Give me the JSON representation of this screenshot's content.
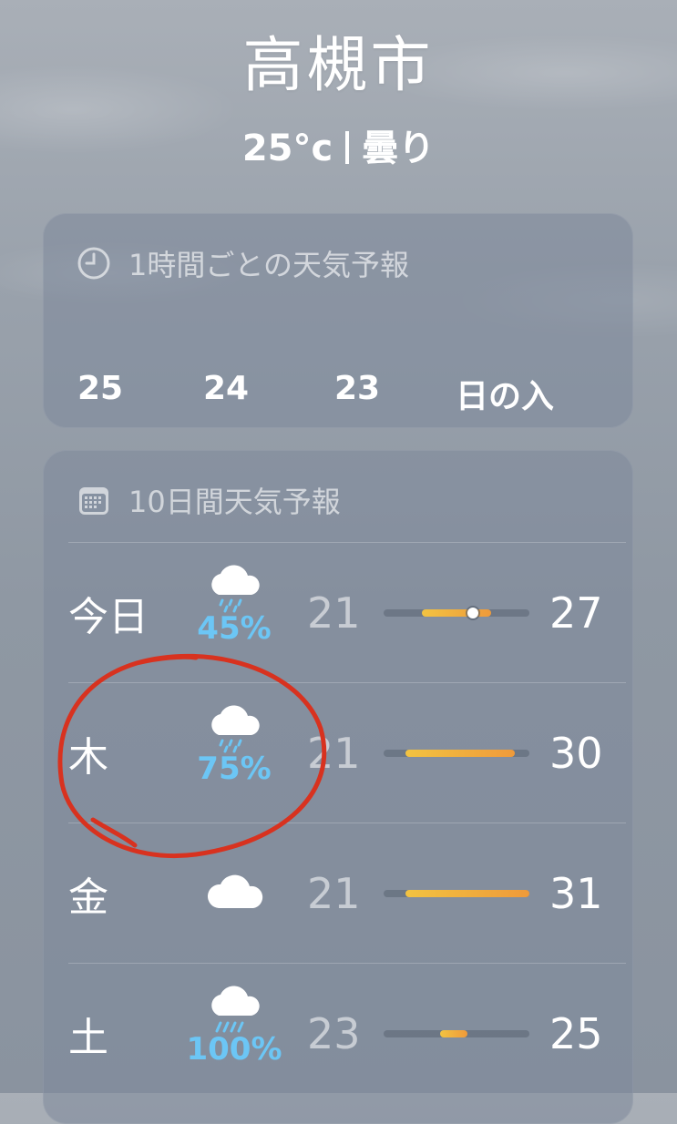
{
  "location": {
    "city": "高槻市",
    "temperature": "25°c",
    "condition": "曇り"
  },
  "hourly": {
    "title": "1時間ごとの天気予報",
    "icon": "clock-icon",
    "items": [
      {
        "label": "25"
      },
      {
        "label": "24"
      },
      {
        "label": "23"
      },
      {
        "label": "日の入"
      }
    ]
  },
  "daily": {
    "title": "10日間天気予報",
    "icon": "calendar-icon",
    "range_low": 21,
    "range_high": 31,
    "days": [
      {
        "name": "今日",
        "icon": "cloud-rain-icon",
        "precip": "45%",
        "low": "21",
        "high": "27",
        "current_temp": 25
      },
      {
        "name": "木",
        "icon": "cloud-rain-icon",
        "precip": "75%",
        "low": "21",
        "high": "30"
      },
      {
        "name": "金",
        "icon": "cloud-icon",
        "precip": "",
        "low": "21",
        "high": "31"
      },
      {
        "name": "土",
        "icon": "cloud-heavy-rain-icon",
        "precip": "100%",
        "low": "23",
        "high": "25"
      }
    ]
  },
  "colors": {
    "precip": "#6cc6f5",
    "bar_start": "#f2c341",
    "bar_end": "#ef9a3a",
    "annotation": "#d8321f"
  }
}
